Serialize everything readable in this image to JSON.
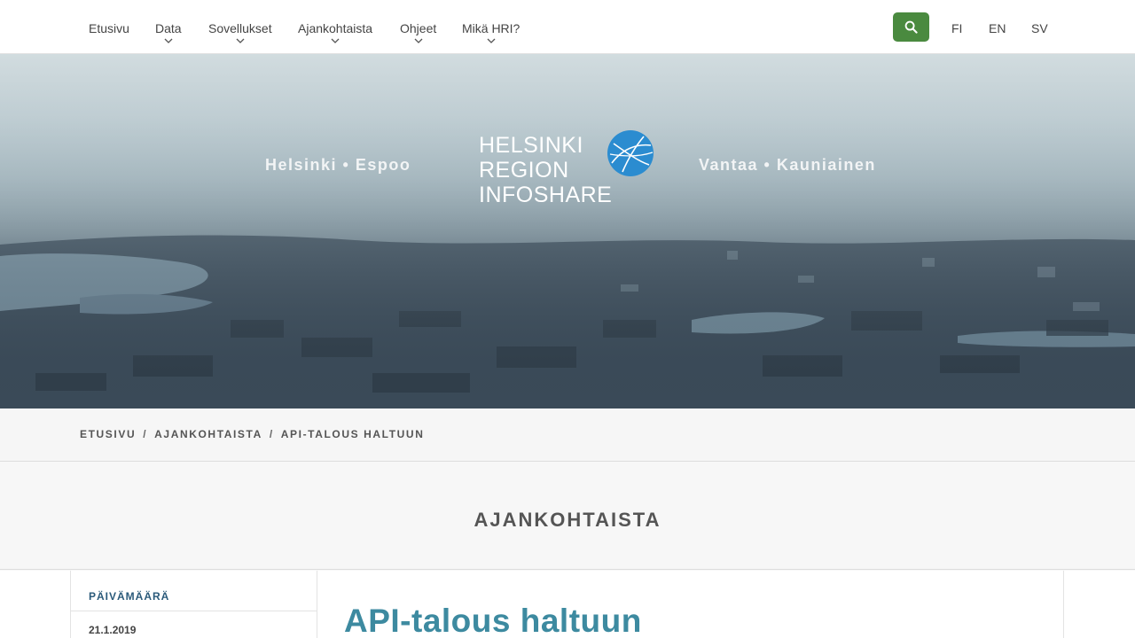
{
  "nav": {
    "items": [
      {
        "label": "Etusivu",
        "has_dropdown": false
      },
      {
        "label": "Data",
        "has_dropdown": true
      },
      {
        "label": "Sovellukset",
        "has_dropdown": true
      },
      {
        "label": "Ajankohtaista",
        "has_dropdown": true
      },
      {
        "label": "Ohjeet",
        "has_dropdown": true
      },
      {
        "label": "Mikä HRI?",
        "has_dropdown": true
      }
    ],
    "search_icon": "search-icon",
    "languages": [
      "FI",
      "EN",
      "SV"
    ],
    "accent_color": "#4a8a3f"
  },
  "hero": {
    "cities_left": "Helsinki  •  Espoo",
    "cities_right": "Vantaa  •  Kauniainen",
    "logo_lines": [
      "HELSINKI",
      "REGION",
      "INFOSHARE"
    ]
  },
  "breadcrumb": {
    "items": [
      "ETUSIVU",
      "AJANKOHTAISTA",
      "API-TALOUS HALTUUN"
    ],
    "separator": "/"
  },
  "section": {
    "title": "AJANKOHTAISTA"
  },
  "article": {
    "date_label": "PÄIVÄMÄÄRÄ",
    "date_value": "21.1.2019",
    "title": "API-talous haltuun",
    "title_color": "#3d8aa0"
  }
}
